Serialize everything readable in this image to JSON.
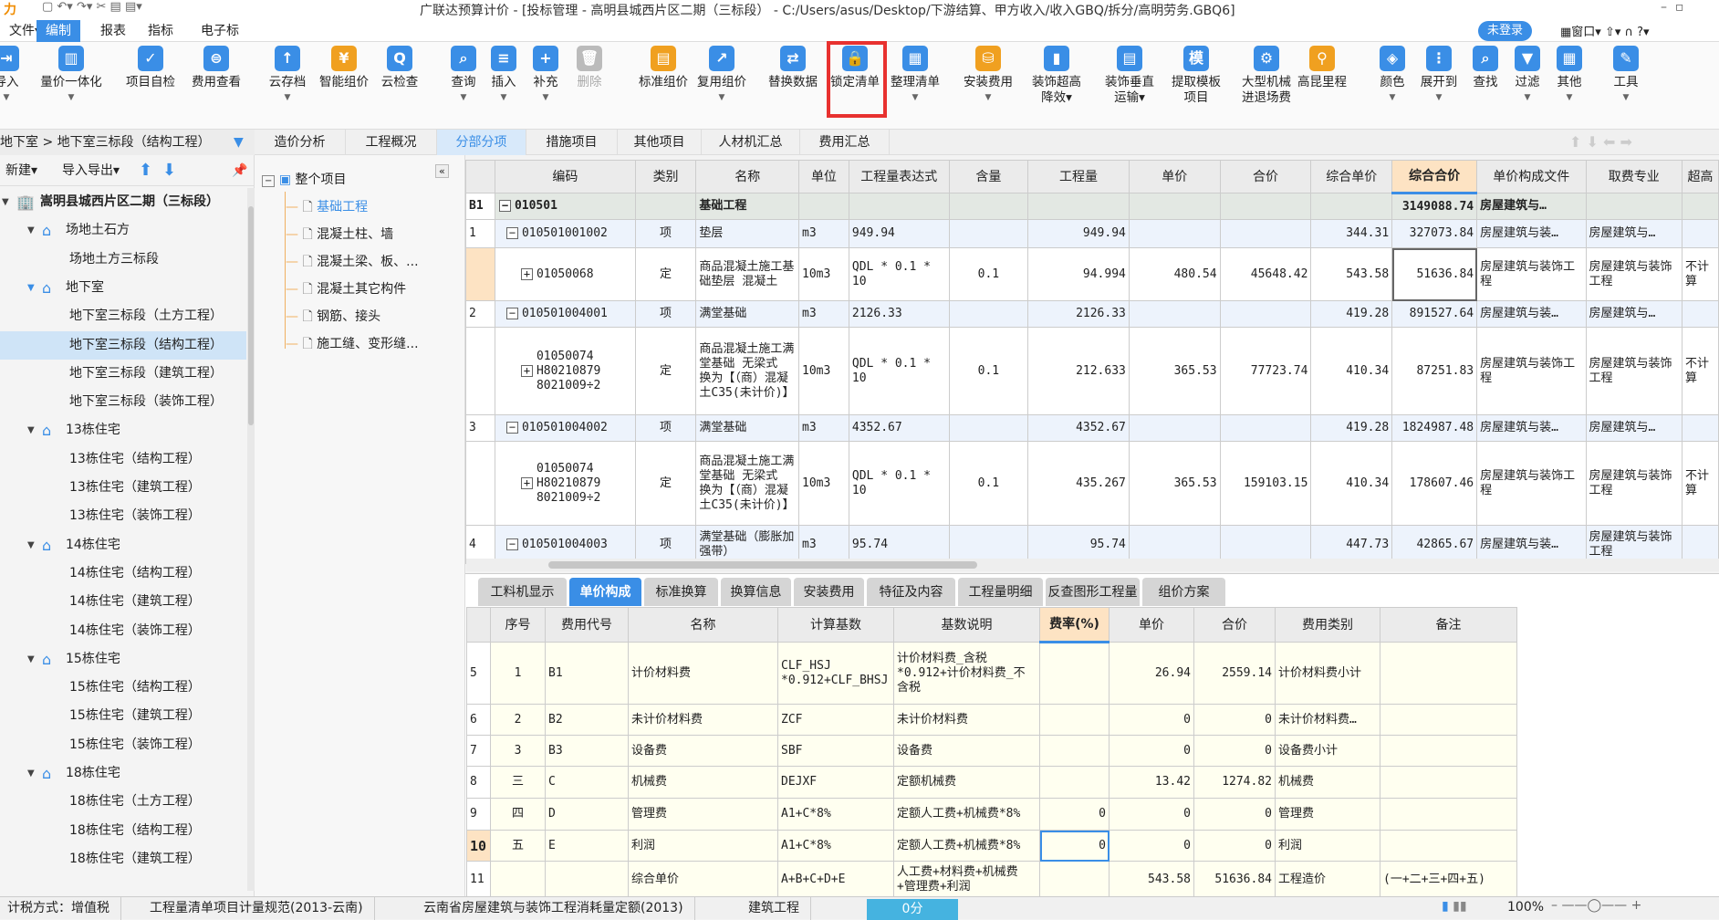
{
  "title": "广联达预算计价 - [投标管理 - 高明县城西片区二期（三标段） - C:/Users/asus/Desktop/下游结算、甲方收入/收入GBQ/拆分/高明劳务.GBQ6]",
  "menus": [
    {
      "label": "文件▾"
    },
    {
      "label": "编制",
      "active": true
    },
    {
      "label": "报表"
    },
    {
      "label": "指标"
    },
    {
      "label": "电子标"
    }
  ],
  "login": "未登录",
  "window_menu": "窗口▾",
  "accent": "#3a8ee6",
  "toolbar": [
    {
      "label": "导入",
      "icon": "import-icon",
      "dd": true,
      "c": "#3a8ee6",
      "g": "⇥"
    },
    {
      "label": "量价一体化",
      "icon": "integration-icon",
      "dd": true,
      "c": "#3a8ee6",
      "g": "▥"
    },
    {
      "label": "项目自检",
      "icon": "self-check-icon",
      "c": "#3a8ee6",
      "g": "✓"
    },
    {
      "label": "费用查看",
      "icon": "cost-view-icon",
      "c": "#3a8ee6",
      "g": "⊜"
    },
    {
      "label": "云存档",
      "icon": "cloud-upload-icon",
      "dd": true,
      "c": "#3a8ee6",
      "g": "↑"
    },
    {
      "label": "智能组价",
      "icon": "smart-price-icon",
      "c": "#f0a020",
      "g": "¥"
    },
    {
      "label": "云检查",
      "icon": "cloud-check-icon",
      "c": "#3a8ee6",
      "g": "Q"
    },
    {
      "label": "查询",
      "icon": "query-icon",
      "dd": true,
      "c": "#3a8ee6",
      "g": "⌕"
    },
    {
      "label": "插入",
      "icon": "insert-icon",
      "dd": true,
      "c": "#3a8ee6",
      "g": "≡"
    },
    {
      "label": "补充",
      "icon": "supplement-icon",
      "dd": true,
      "c": "#3a8ee6",
      "g": "+"
    },
    {
      "label": "删除",
      "icon": "delete-icon",
      "c": "#bbbbbb",
      "g": "🗑",
      "disabled": true
    },
    {
      "label": "标准组价",
      "icon": "standard-price-icon",
      "c": "#f0a020",
      "g": "▤"
    },
    {
      "label": "复用组价",
      "icon": "reuse-price-icon",
      "dd": true,
      "c": "#3a8ee6",
      "g": "↗"
    },
    {
      "label": "替换数据",
      "icon": "replace-data-icon",
      "c": "#3a8ee6",
      "g": "⇄"
    },
    {
      "label": "锁定清单",
      "icon": "lock-icon",
      "c": "#3a8ee6",
      "g": "🔒"
    },
    {
      "label": "整理清单",
      "icon": "organize-list-icon",
      "dd": true,
      "c": "#3a8ee6",
      "g": "▦"
    },
    {
      "label": "安装费用",
      "icon": "install-cost-icon",
      "dd": true,
      "c": "#f0a020",
      "g": "⛁"
    },
    {
      "label": "装饰超高\n降效▾",
      "icon": "decoration-height-icon",
      "c": "#3a8ee6",
      "g": "▮"
    },
    {
      "label": "装饰垂直\n运输▾",
      "icon": "vertical-transport-icon",
      "c": "#3a8ee6",
      "g": "▤"
    },
    {
      "label": "提取模板\n项目",
      "icon": "template-icon",
      "c": "#3a8ee6",
      "g": "模"
    },
    {
      "label": "大型机械\n进退场费",
      "icon": "machinery-icon",
      "c": "#3a8ee6",
      "g": "⚙"
    },
    {
      "label": "高昆里程",
      "icon": "mileage-icon",
      "c": "#f0a020",
      "g": "⚲"
    },
    {
      "label": "颜色",
      "icon": "color-icon",
      "dd": true,
      "c": "#3a8ee6",
      "g": "◈"
    },
    {
      "label": "展开到",
      "icon": "expand-icon",
      "dd": true,
      "c": "#3a8ee6",
      "g": "⋮"
    },
    {
      "label": "查找",
      "icon": "find-icon",
      "c": "#3a8ee6",
      "g": "⌕"
    },
    {
      "label": "过滤",
      "icon": "filter-icon",
      "dd": true,
      "c": "#3a8ee6",
      "g": "▼"
    },
    {
      "label": "其他",
      "icon": "other-icon",
      "dd": true,
      "c": "#3a8ee6",
      "g": "▦"
    },
    {
      "label": "工具",
      "icon": "tools-icon",
      "dd": true,
      "c": "#3a8ee6",
      "g": "✎"
    }
  ],
  "breadcrumb": "地下室 > 地下室三标段（结构工程）",
  "left_tools": {
    "new": "新建▾",
    "io": "导入导出▾"
  },
  "project_tree": [
    {
      "label": "嵩明县城西片区二期（三标段）",
      "level": 0,
      "bold": true,
      "icon": "building-icon"
    },
    {
      "label": "场地土石方",
      "level": 1,
      "icon": "house-icon"
    },
    {
      "label": "场地土方三标段",
      "level": 2
    },
    {
      "label": "地下室",
      "level": 1,
      "icon": "house-icon",
      "blue": true
    },
    {
      "label": "地下室三标段（土方工程）",
      "level": 2
    },
    {
      "label": "地下室三标段（结构工程）",
      "level": 2,
      "selected": true
    },
    {
      "label": "地下室三标段（建筑工程）",
      "level": 2
    },
    {
      "label": "地下室三标段（装饰工程）",
      "level": 2
    },
    {
      "label": "13栋住宅",
      "level": 1,
      "icon": "house-icon"
    },
    {
      "label": "13栋住宅（结构工程）",
      "level": 2
    },
    {
      "label": "13栋住宅（建筑工程）",
      "level": 2
    },
    {
      "label": "13栋住宅（装饰工程）",
      "level": 2
    },
    {
      "label": "14栋住宅",
      "level": 1,
      "icon": "house-icon"
    },
    {
      "label": "14栋住宅（结构工程）",
      "level": 2
    },
    {
      "label": "14栋住宅（建筑工程）",
      "level": 2
    },
    {
      "label": "14栋住宅（装饰工程）",
      "level": 2
    },
    {
      "label": "15栋住宅",
      "level": 1,
      "icon": "house-icon"
    },
    {
      "label": "15栋住宅（结构工程）",
      "level": 2
    },
    {
      "label": "15栋住宅（建筑工程）",
      "level": 2
    },
    {
      "label": "15栋住宅（装饰工程）",
      "level": 2
    },
    {
      "label": "18栋住宅",
      "level": 1,
      "icon": "house-icon"
    },
    {
      "label": "18栋住宅（土方工程）",
      "level": 2
    },
    {
      "label": "18栋住宅（结构工程）",
      "level": 2
    },
    {
      "label": "18栋住宅（建筑工程）",
      "level": 2
    }
  ],
  "section_tree": {
    "root": "整个项目",
    "items": [
      "基础工程",
      "混凝土柱、墙",
      "混凝土梁、板、...",
      "混凝土其它构件",
      "钢筋、接头",
      "施工缝、变形缝..."
    ],
    "active": 0
  },
  "page_tabs": [
    {
      "label": "造价分析"
    },
    {
      "label": "工程概况"
    },
    {
      "label": "分部分项",
      "active": true
    },
    {
      "label": "措施项目"
    },
    {
      "label": "其他项目"
    },
    {
      "label": "人材机汇总"
    },
    {
      "label": "费用汇总"
    }
  ],
  "main_table": {
    "columns": [
      "",
      "编码",
      "类别",
      "名称",
      "单位",
      "工程量表达式",
      "含量",
      "工程量",
      "单价",
      "合价",
      "综合单价",
      "综合合价",
      "单价构成文件",
      "取费专业",
      "超高"
    ],
    "hot_column": 11,
    "rows": [
      {
        "type": "grp",
        "cells": [
          "B1",
          "010501",
          "",
          "基础工程",
          "",
          "",
          "",
          "",
          "",
          "",
          "",
          "3149088.74",
          "房屋建筑与…",
          "",
          ""
        ]
      },
      {
        "type": "item",
        "cells": [
          "1",
          "010501001002",
          "项",
          "垫层",
          "m3",
          "949.94",
          "",
          "949.94",
          "",
          "",
          "344.31",
          "327073.84",
          "房屋建筑与装…",
          "房屋建筑与…",
          ""
        ]
      },
      {
        "type": "def",
        "cells": [
          "",
          "01050068",
          "定",
          "商品混凝土施工基础垫层 混凝土",
          "10m3",
          "QDL * 0.1 * 10",
          "0.1",
          "94.994",
          "480.54",
          "45648.42",
          "543.58",
          "51636.84",
          "房屋建筑与装饰工程",
          "房屋建筑与装饰工程",
          "不计算"
        ],
        "selected_col": 11
      },
      {
        "type": "item",
        "cells": [
          "2",
          "010501004001",
          "项",
          "满堂基础",
          "m3",
          "2126.33",
          "",
          "2126.33",
          "",
          "",
          "419.28",
          "891527.64",
          "房屋建筑与装…",
          "房屋建筑与…",
          ""
        ]
      },
      {
        "type": "def",
        "cells": [
          "",
          "01050074 H80210879 8021009÷2",
          "定",
          "商品混凝土施工满堂基础 无梁式 换为【（商）混凝土C35(未计价)】",
          "10m3",
          "QDL * 0.1 * 10",
          "0.1",
          "212.633",
          "365.53",
          "77723.74",
          "410.34",
          "87251.83",
          "房屋建筑与装饰工程",
          "房屋建筑与装饰工程",
          "不计算"
        ]
      },
      {
        "type": "item",
        "cells": [
          "3",
          "010501004002",
          "项",
          "满堂基础",
          "m3",
          "4352.67",
          "",
          "4352.67",
          "",
          "",
          "419.28",
          "1824987.48",
          "房屋建筑与装…",
          "房屋建筑与…",
          ""
        ]
      },
      {
        "type": "def",
        "cells": [
          "",
          "01050074 H80210879 8021009÷2",
          "定",
          "商品混凝土施工满堂基础 无梁式 换为【（商）混凝土C35(未计价)】",
          "10m3",
          "QDL * 0.1 * 10",
          "0.1",
          "435.267",
          "365.53",
          "159103.15",
          "410.34",
          "178607.46",
          "房屋建筑与装饰工程",
          "房屋建筑与装饰工程",
          "不计算"
        ]
      },
      {
        "type": "item",
        "cells": [
          "4",
          "010501004003",
          "项",
          "满堂基础（膨胀加强带）",
          "m3",
          "95.74",
          "",
          "95.74",
          "",
          "",
          "447.73",
          "42865.67",
          "房屋建筑与装…",
          "房屋建筑与装饰工程",
          ""
        ]
      }
    ]
  },
  "bottom_tabs": [
    {
      "label": "工料机显示"
    },
    {
      "label": "单价构成",
      "active": true
    },
    {
      "label": "标准换算"
    },
    {
      "label": "换算信息"
    },
    {
      "label": "安装费用"
    },
    {
      "label": "特征及内容"
    },
    {
      "label": "工程量明细"
    },
    {
      "label": "反查图形工程量"
    },
    {
      "label": "组价方案"
    }
  ],
  "cost_table": {
    "columns": [
      "",
      "序号",
      "费用代号",
      "名称",
      "计算基数",
      "基数说明",
      "费率(%)",
      "单价",
      "合价",
      "费用类别",
      "备注"
    ],
    "hot_column": 6,
    "rows": [
      [
        "5",
        "1",
        "B1",
        "计价材料费",
        "CLF_HSJ *0.912+CLF_BHSJ",
        "计价材料费_含税*0.912+计价材料费_不含税",
        "",
        "26.94",
        "2559.14",
        "计价材料费小计",
        ""
      ],
      [
        "6",
        "2",
        "B2",
        "未计价材料费",
        "ZCF",
        "未计价材料费",
        "",
        "0",
        "0",
        "未计价材料费…",
        ""
      ],
      [
        "7",
        "3",
        "B3",
        "设备费",
        "SBF",
        "设备费",
        "",
        "0",
        "0",
        "设备费小计",
        ""
      ],
      [
        "8",
        "三",
        "C",
        "机械费",
        "DEJXF",
        "定额机械费",
        "",
        "13.42",
        "1274.82",
        "机械费",
        ""
      ],
      [
        "9",
        "四",
        "D",
        "管理费",
        "A1+C*8%",
        "定额人工费+机械费*8%",
        "0",
        "0",
        "0",
        "管理费",
        ""
      ],
      [
        "10",
        "五",
        "E",
        "利润",
        "A1+C*8%",
        "定额人工费+机械费*8%",
        "0",
        "0",
        "0",
        "利润",
        ""
      ],
      [
        "11",
        "",
        "",
        "综合单价",
        "A+B+C+D+E",
        "人工费+材料费+机械费+管理费+利润",
        "",
        "543.58",
        "51636.84",
        "工程造价",
        "(一+二+三+四+五)"
      ]
    ],
    "active_row": 5
  },
  "status": {
    "tax": "计税方式：增值税",
    "spec": "工程量清单项目计量规范(2013-云南)",
    "quota": "云南省房屋建筑与装饰工程消耗量定额(2013)",
    "type": "建筑工程",
    "score": "0分",
    "zoom": "100%"
  }
}
